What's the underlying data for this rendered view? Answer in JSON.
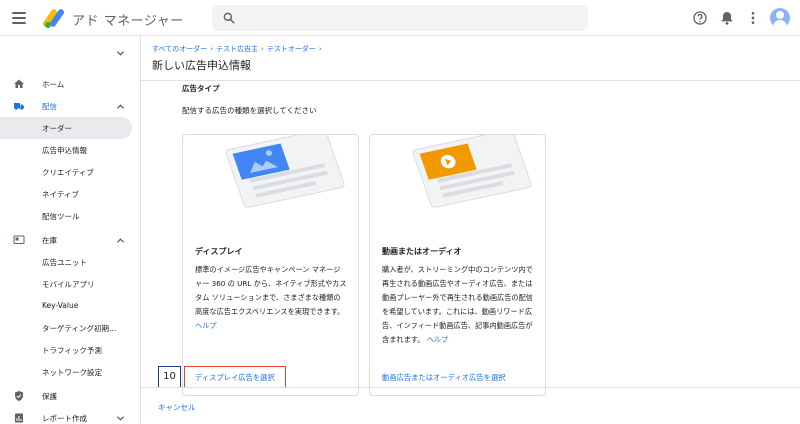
{
  "app": {
    "title": "アド マネージャー"
  },
  "colors": {
    "accent": "#1a73e8",
    "highlight": "#ea4335",
    "badge_border": "#1f3a93",
    "display_card": "#4285f4",
    "video_card": "#f29900"
  },
  "icons": {
    "menu": "hamburger-icon",
    "search": "search-icon",
    "help": "help-icon",
    "notifications": "bell-icon",
    "more": "more-vert-icon",
    "account": "avatar"
  },
  "sidebar": {
    "items": [
      {
        "label": "ホーム",
        "icon": "home-icon"
      },
      {
        "label": "配信",
        "icon": "truck-icon",
        "expanded": true
      },
      {
        "label": "オーダー",
        "selected": true
      },
      {
        "label": "広告申込情報"
      },
      {
        "label": "クリエイティブ"
      },
      {
        "label": "ネイティブ"
      },
      {
        "label": "配信ツール"
      },
      {
        "label": "在庫",
        "icon": "inventory-icon",
        "expanded": true
      },
      {
        "label": "広告ユニット"
      },
      {
        "label": "モバイルアプリ"
      },
      {
        "label": "Key-Value"
      },
      {
        "label": "ターゲティング初期..."
      },
      {
        "label": "トラフィック予測"
      },
      {
        "label": "ネットワーク設定"
      },
      {
        "label": "保護",
        "icon": "shield-icon"
      },
      {
        "label": "レポート作成",
        "icon": "report-icon"
      }
    ]
  },
  "breadcrumb": {
    "items": [
      "すべてのオーダー",
      "テスト広告主",
      "テストオーダー"
    ],
    "separator": "›"
  },
  "page": {
    "title": "新しい広告申込情報"
  },
  "section": {
    "title": "広告タイプ",
    "description": "配信する広告の種類を選択してください"
  },
  "cards": [
    {
      "title": "ディスプレイ",
      "description": "標準のイメージ広告やキャンペーン マネージャー 360 の URL から、ネイティブ形式やカスタム ソリューションまで、さまざまな種類の高度な広告エクスペリエンスを実現できます。",
      "help": "ヘルプ",
      "action": "ディスプレイ広告を選択"
    },
    {
      "title": "動画またはオーディオ",
      "description": "購入者が、ストリーミング中のコンテンツ内で再生される動画広告やオーディオ広告、または動画プレーヤー外で再生される動画広告の配信を希望しています。これには、動画リワード広告、インフィード動画広告、記事内動画広告が含まれます。",
      "help": "ヘルプ",
      "action": "動画広告またはオーディオ広告を選択"
    }
  ],
  "annotation": {
    "step": "10"
  },
  "footer": {
    "cancel": "キャンセル"
  }
}
